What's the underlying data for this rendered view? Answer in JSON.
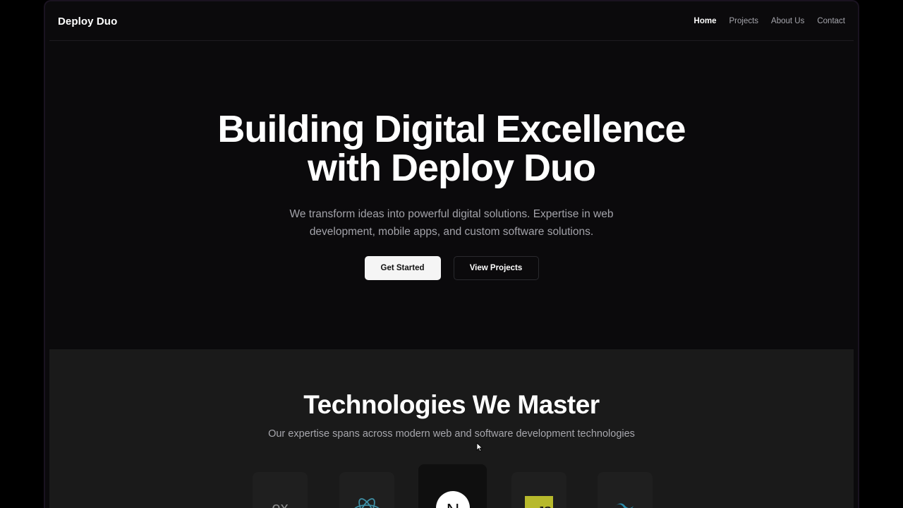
{
  "brand": "Deploy Duo",
  "nav": {
    "links": [
      {
        "label": "Home",
        "active": true
      },
      {
        "label": "Projects",
        "active": false
      },
      {
        "label": "About Us",
        "active": false
      },
      {
        "label": "Contact",
        "active": false
      }
    ]
  },
  "hero": {
    "title_line1": "Building Digital Excellence",
    "title_line2": "with Deploy Duo",
    "subtitle_line1": "We transform ideas into powerful digital solutions. Expertise in web",
    "subtitle_line2": "development, mobile apps, and custom software solutions.",
    "primary_button": "Get Started",
    "secondary_button": "View Projects"
  },
  "technologies": {
    "title": "Technologies We Master",
    "subtitle": "Our expertise spans across modern web and software development technologies",
    "items": [
      {
        "icon": "express-icon",
        "glyph": "ex"
      },
      {
        "icon": "react-icon"
      },
      {
        "icon": "nextjs-icon",
        "glyph": "N"
      },
      {
        "icon": "javascript-icon",
        "glyph": "JS"
      },
      {
        "icon": "tailwind-icon"
      }
    ]
  },
  "colors": {
    "background": "#0b0a0c",
    "section_background": "#1a1a1a",
    "text_primary": "#ffffff",
    "text_muted": "#a3a3aa",
    "react_color": "#61dafb",
    "javascript_color": "#c8cc2a",
    "tailwind_color": "#38bdf8"
  }
}
